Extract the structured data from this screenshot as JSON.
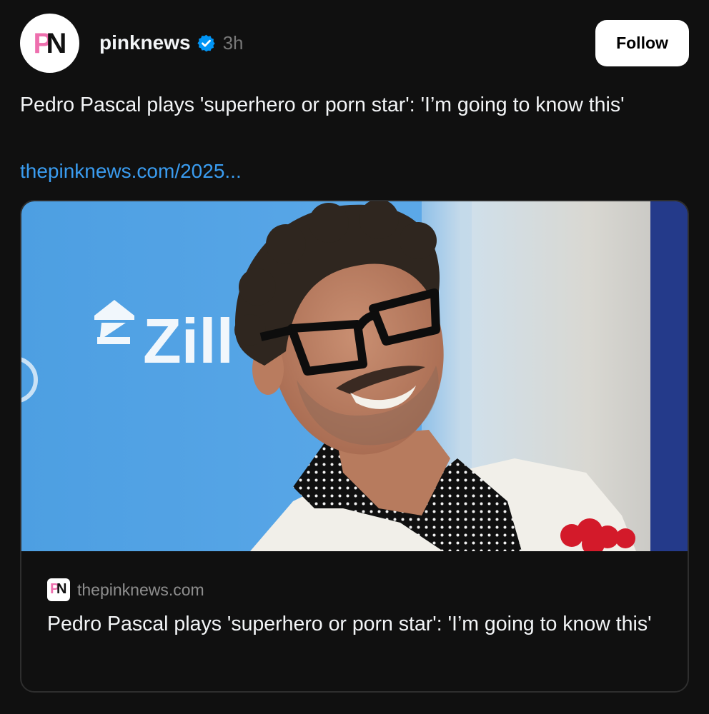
{
  "author": {
    "handle": "pinknews",
    "timestamp": "3h",
    "avatar_icon": "pinknews-logo",
    "avatar_text": "PN",
    "verified": true,
    "verified_color": "#0095f6"
  },
  "follow_button": {
    "label": "Follow"
  },
  "post": {
    "text": "Pedro Pascal plays 'superhero or porn star': 'I’m going to know this'",
    "link_text": "thepinknews.com/2025..."
  },
  "link_card": {
    "image_alt": "Pedro Pascal smiling in black glasses at a red carpet event",
    "backdrop_text": "Zill",
    "source_domain": "thepinknews.com",
    "title": "Pedro Pascal plays 'superhero or porn star': 'I’m going to know this'"
  },
  "colors": {
    "background": "#101010",
    "link": "#3a9cf0",
    "brand_pink": "#ee6fae"
  }
}
